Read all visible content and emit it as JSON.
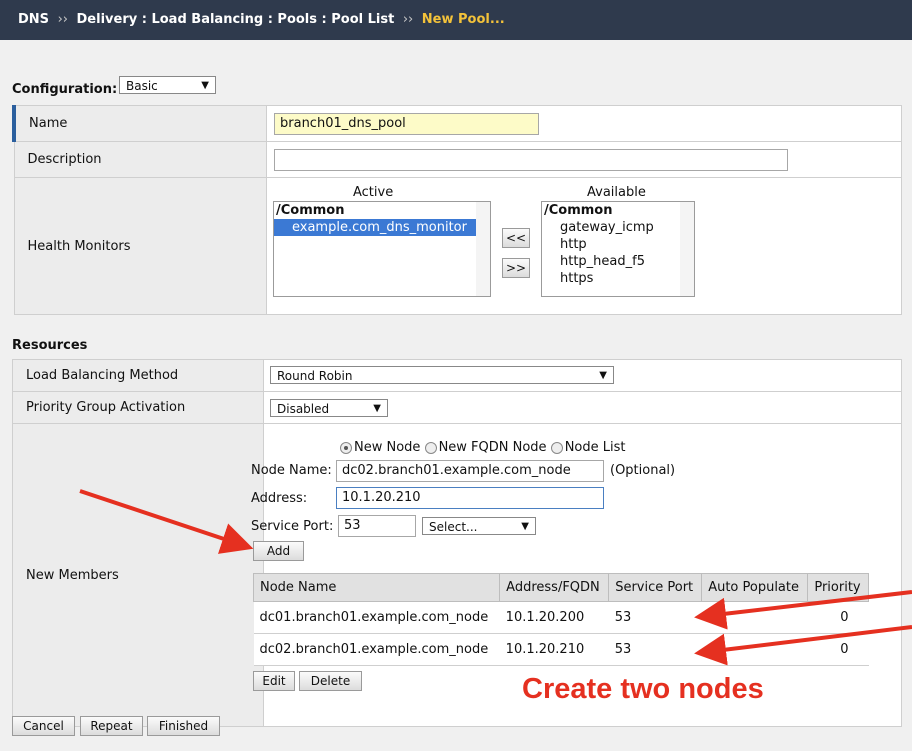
{
  "breadcrumb": {
    "section": "DNS",
    "path": "Delivery : Load Balancing : Pools : Pool List",
    "current": "New Pool...",
    "separator": "››"
  },
  "configuration": {
    "label": "Configuration:",
    "mode": "Basic"
  },
  "fields": {
    "name": {
      "label": "Name",
      "value": "branch01_dns_pool"
    },
    "description": {
      "label": "Description",
      "value": ""
    },
    "health_monitors": {
      "label": "Health Monitors",
      "active_title": "Active",
      "available_title": "Available",
      "active_group": "/Common",
      "active_items": [
        "example.com_dns_monitor"
      ],
      "available_group": "/Common",
      "available_items": [
        "gateway_icmp",
        "http",
        "http_head_f5",
        "https"
      ],
      "move_left_label": "<<",
      "move_right_label": ">>"
    }
  },
  "resources": {
    "heading": "Resources",
    "lb_method": {
      "label": "Load Balancing Method",
      "value": "Round Robin"
    },
    "priority_group": {
      "label": "Priority Group Activation",
      "value": "Disabled"
    },
    "new_members": {
      "label": "New Members",
      "radio_new_node": "New Node",
      "radio_fqdn": "New FQDN Node",
      "radio_node_list": "Node List",
      "node_name_label": "Node Name:",
      "node_name_value": "dc02.branch01.example.com_node",
      "optional_label": "(Optional)",
      "address_label": "Address:",
      "address_value": "10.1.20.210",
      "service_port_label": "Service Port:",
      "service_port_value": "53",
      "service_select": "Select...",
      "add_label": "Add",
      "columns": [
        "Node Name",
        "Address/FQDN",
        "Service Port",
        "Auto Populate",
        "Priority"
      ],
      "rows": [
        {
          "node": "dc01.branch01.example.com_node",
          "address": "10.1.20.200",
          "port": "53",
          "auto": "",
          "priority": "0"
        },
        {
          "node": "dc02.branch01.example.com_node",
          "address": "10.1.20.210",
          "port": "53",
          "auto": "",
          "priority": "0"
        }
      ],
      "edit_label": "Edit",
      "delete_label": "Delete"
    }
  },
  "footer": {
    "cancel": "Cancel",
    "repeat": "Repeat",
    "finished": "Finished"
  },
  "annotation": {
    "text": "Create two nodes",
    "color": "#e53020"
  }
}
